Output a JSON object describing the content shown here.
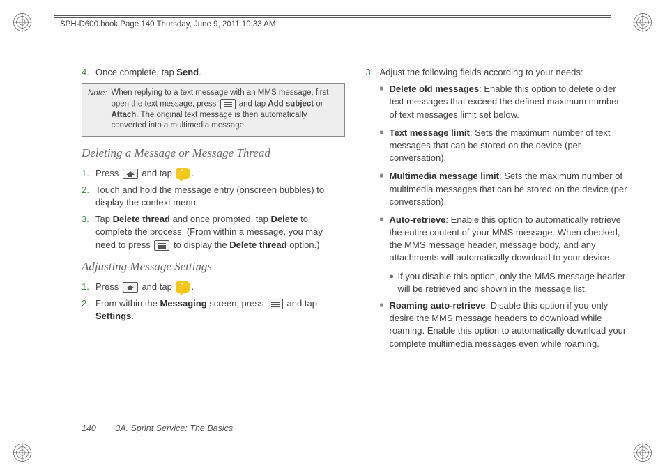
{
  "header": "SPH-D600.book  Page 140  Thursday, June 9, 2011  10:33 AM",
  "left": {
    "step4": {
      "num": "4.",
      "text_a": "Once complete, tap ",
      "bold": "Send",
      "text_b": "."
    },
    "note": {
      "label": "Note:",
      "body_a": "When replying to a text message with an MMS message, first open the text message, press ",
      "body_b": " and tap ",
      "bold1": "Add subject",
      "body_c": " or ",
      "bold2": "Attach",
      "body_d": ". The original text message is then automatically converted into a multimedia message."
    },
    "h1": "Deleting a Message or Message Thread",
    "d1": {
      "num": "1.",
      "a": "Press ",
      "b": " and tap ",
      "c": "."
    },
    "d2": {
      "num": "2.",
      "text": "Touch and hold the message entry (onscreen bubbles) to display the context menu."
    },
    "d3": {
      "num": "3.",
      "a": "Tap ",
      "bold1": "Delete thread",
      "b": " and once prompted, tap ",
      "bold2": "Delete",
      "c": " to complete the process. (From within a message, you may need to press ",
      "d": " to display the ",
      "bold3": "Delete thread",
      "e": " option.)"
    },
    "h2": "Adjusting Message Settings",
    "a1": {
      "num": "1.",
      "a": "Press ",
      "b": " and tap ",
      "c": "."
    },
    "a2": {
      "num": "2.",
      "a": "From within the ",
      "bold1": "Messaging",
      "b": " screen, press ",
      "c": " and tap ",
      "bold2": "Settings",
      "d": "."
    }
  },
  "right": {
    "step3": {
      "num": "3.",
      "text": "Adjust the following fields according to your needs:"
    },
    "b1": {
      "bold": "Delete old messages",
      "text": ": Enable this option to delete older text messages that exceed the defined maximum number of text messages limit set below."
    },
    "b2": {
      "bold": "Text message limit",
      "text": ": Sets the maximum number of text messages that can be stored on the device (per conversation)."
    },
    "b3": {
      "bold": "Multimedia message limit",
      "text": ": Sets the maximum number of multimedia messages that can be stored on the device (per conversation)."
    },
    "b4": {
      "bold": "Auto-retrieve",
      "text": ": Enable this option to automatically retrieve the entire content of your MMS message. When checked, the MMS message header, message body, and any attachments will automatically download to your device."
    },
    "b4sub": "If you disable this option, only the MMS message header will be retrieved and shown in the message list.",
    "b5": {
      "bold": "Roaming auto-retrieve",
      "text": ": Disable this option if you only desire the MMS message headers to download while roaming. Enable this option to automatically download your complete multimedia messages even while roaming."
    }
  },
  "footer": {
    "page": "140",
    "section": "3A. Sprint Service: The Basics"
  }
}
